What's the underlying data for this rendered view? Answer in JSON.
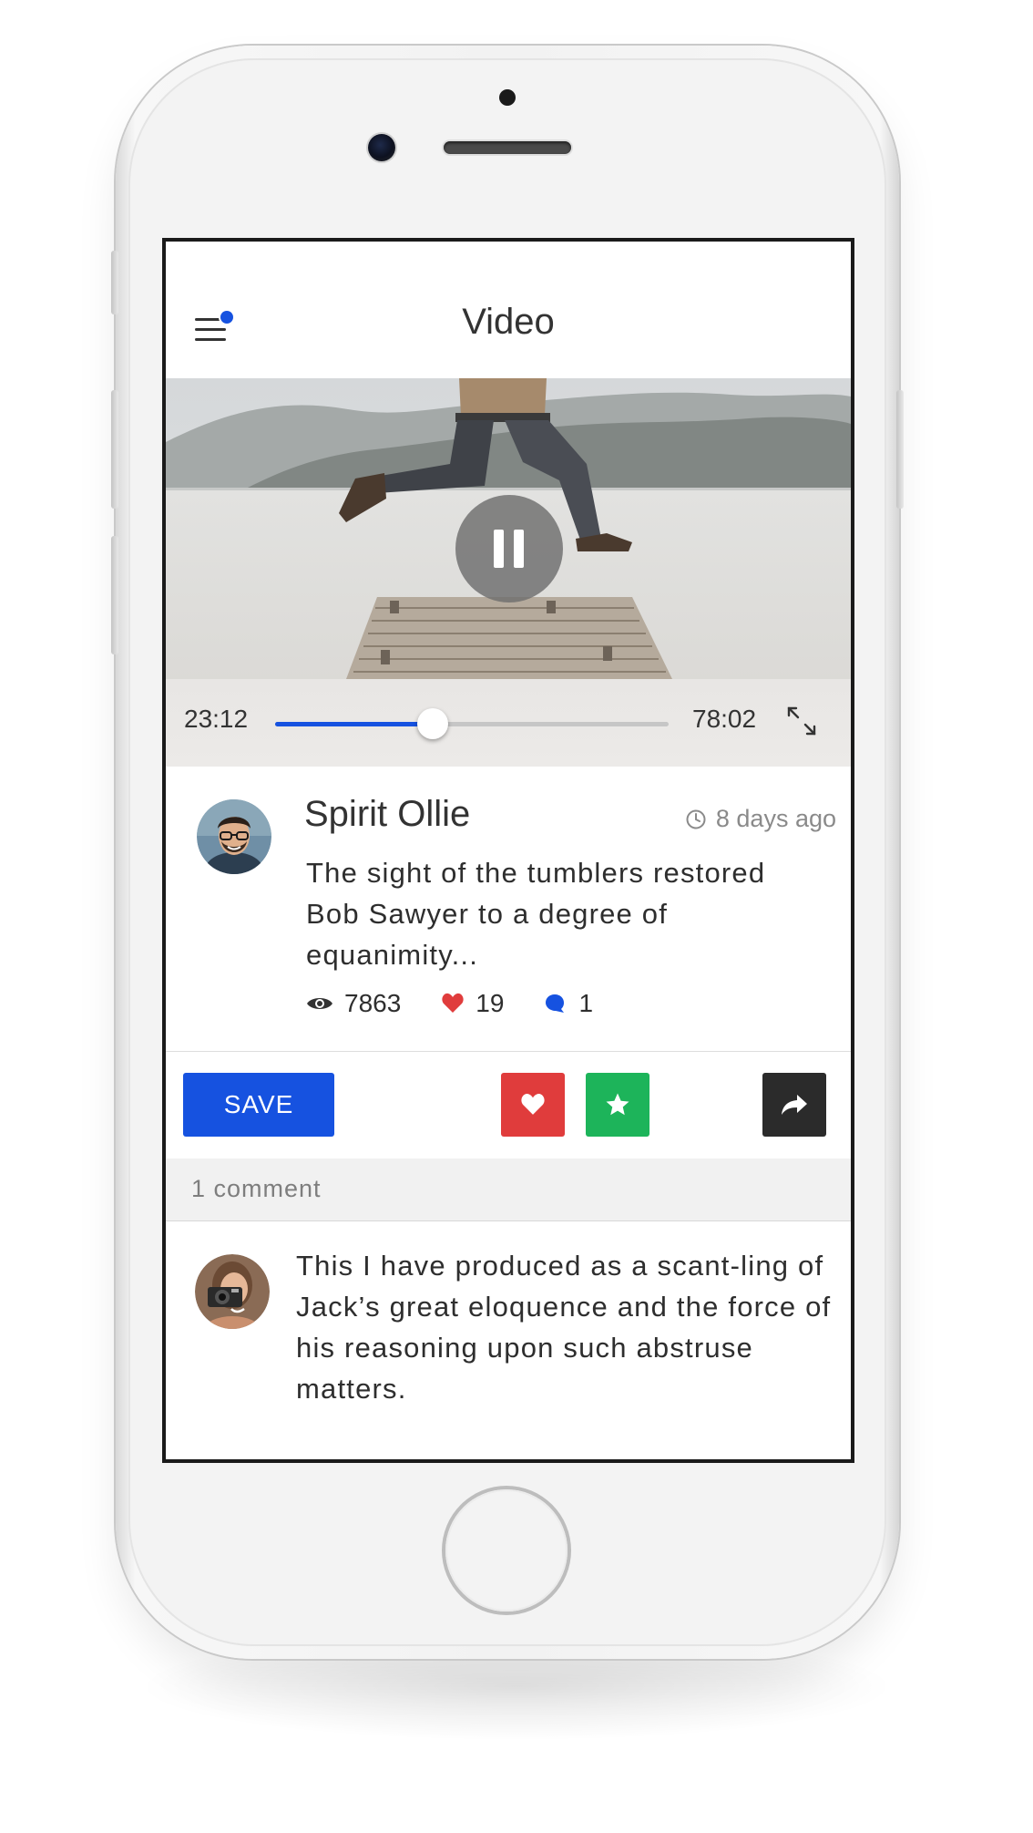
{
  "header": {
    "title": "Video",
    "menu_icon": "hamburger-menu-icon",
    "notification_color": "#1652e0"
  },
  "player": {
    "elapsed": "23:12",
    "duration": "78:02",
    "progress_fraction": 0.4,
    "buffered_fraction": 0.62,
    "state": "playing",
    "pause_icon": "pause-icon",
    "expand_icon": "expand-icon",
    "accent_color": "#1652e0"
  },
  "post": {
    "author": "Spirit Ollie",
    "time": "8 days ago",
    "text": "The sight of the tumblers restored Bob Sawyer to a degree of equanimity...",
    "views": "7863",
    "likes": "19",
    "comments": "1"
  },
  "actions": {
    "save_label": "SAVE",
    "like_color": "#e03c3c",
    "favorite_color": "#1db45a",
    "share_color": "#2b2b2b"
  },
  "comments_section": {
    "count_label": "1 comment",
    "items": [
      {
        "text": "This I have produced as a scant-ling of Jack’s great eloquence and the force of his reasoning upon such abstruse matters."
      }
    ]
  }
}
